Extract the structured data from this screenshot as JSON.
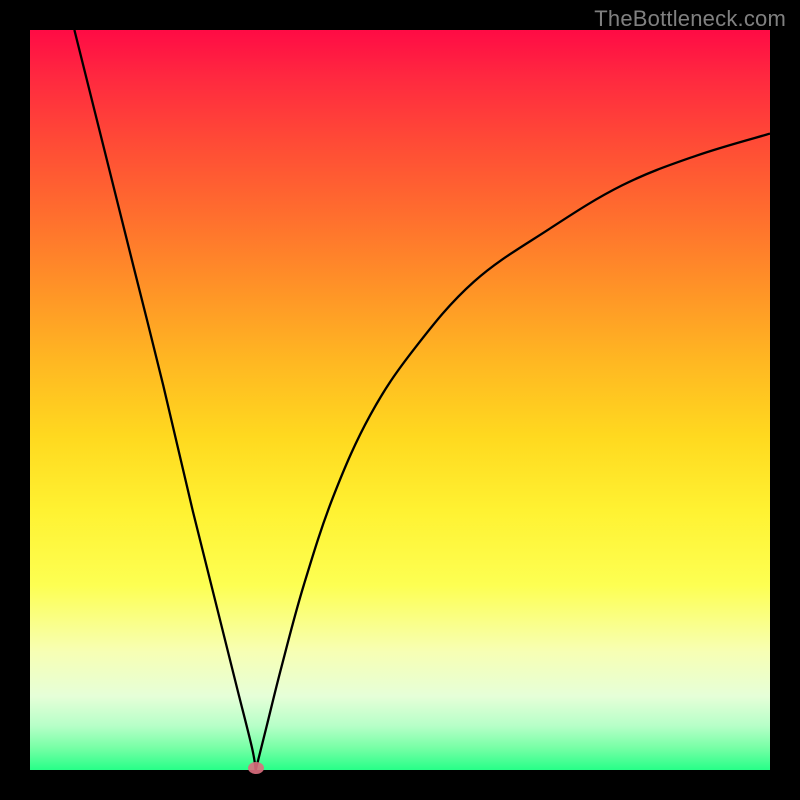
{
  "watermark": "TheBottleneck.com",
  "marker": {
    "x_pct": 30.5,
    "y_pct": 0
  },
  "chart_data": {
    "type": "line",
    "title": "",
    "xlabel": "",
    "ylabel": "",
    "xlim": [
      0,
      100
    ],
    "ylim": [
      0,
      100
    ],
    "grid": false,
    "legend": false,
    "series": [
      {
        "name": "left-branch",
        "x": [
          6,
          10,
          14,
          18,
          22,
          26,
          28,
          30,
          30.5
        ],
        "y": [
          100,
          84,
          68,
          52,
          35,
          19,
          11,
          3,
          0
        ]
      },
      {
        "name": "right-branch",
        "x": [
          30.5,
          32,
          34,
          37,
          41,
          46,
          52,
          60,
          70,
          80,
          90,
          100
        ],
        "y": [
          0,
          6,
          14,
          25,
          37,
          48,
          57,
          66,
          73,
          79,
          83,
          86
        ]
      }
    ]
  }
}
